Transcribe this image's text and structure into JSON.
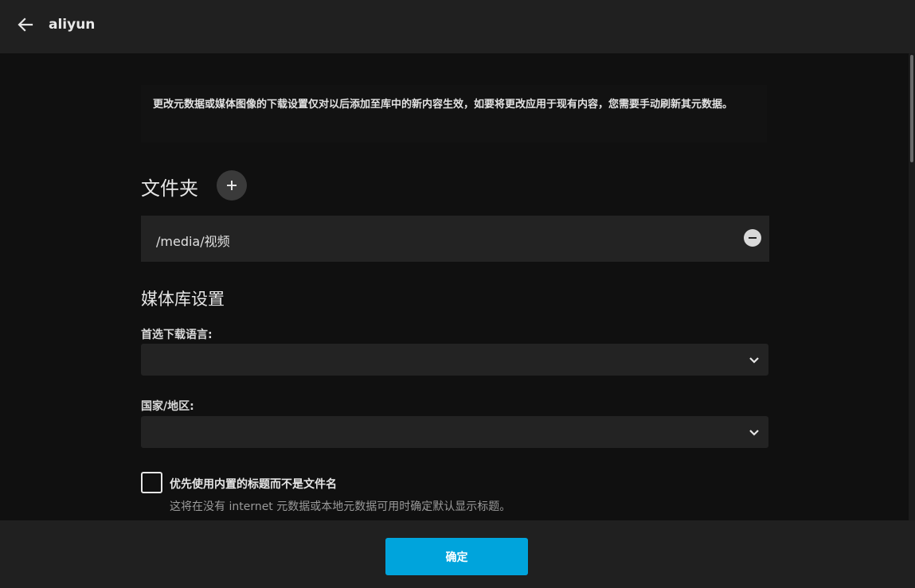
{
  "header": {
    "back_icon": "arrow-left-icon",
    "title": "aliyun"
  },
  "notice": {
    "text": "更改元数据或媒体图像的下载设置仅对以后添加至库中的新内容生效，如要将更改应用于现有内容，您需要手动刷新其元数据。"
  },
  "folders": {
    "title": "文件夹",
    "add_icon": "plus-icon",
    "items": [
      {
        "path": "/media/视频",
        "remove_icon": "minus-circle-icon"
      }
    ]
  },
  "library_settings": {
    "title": "媒体库设置",
    "preferred_language": {
      "label": "首选下载语言:",
      "value": "",
      "icon": "chevron-down-icon"
    },
    "country_region": {
      "label": "国家/地区:",
      "value": "",
      "icon": "chevron-down-icon"
    },
    "prefer_embedded_titles": {
      "checked": false,
      "label": "优先使用内置的标题而不是文件名",
      "description": "这将在没有 internet 元数据或本地元数据可用时确定默认显示标题。"
    }
  },
  "footer": {
    "confirm_label": "确定"
  },
  "colors": {
    "accent": "#00a4dc",
    "background": "#101010",
    "surface": "#232323",
    "header": "#202020"
  }
}
